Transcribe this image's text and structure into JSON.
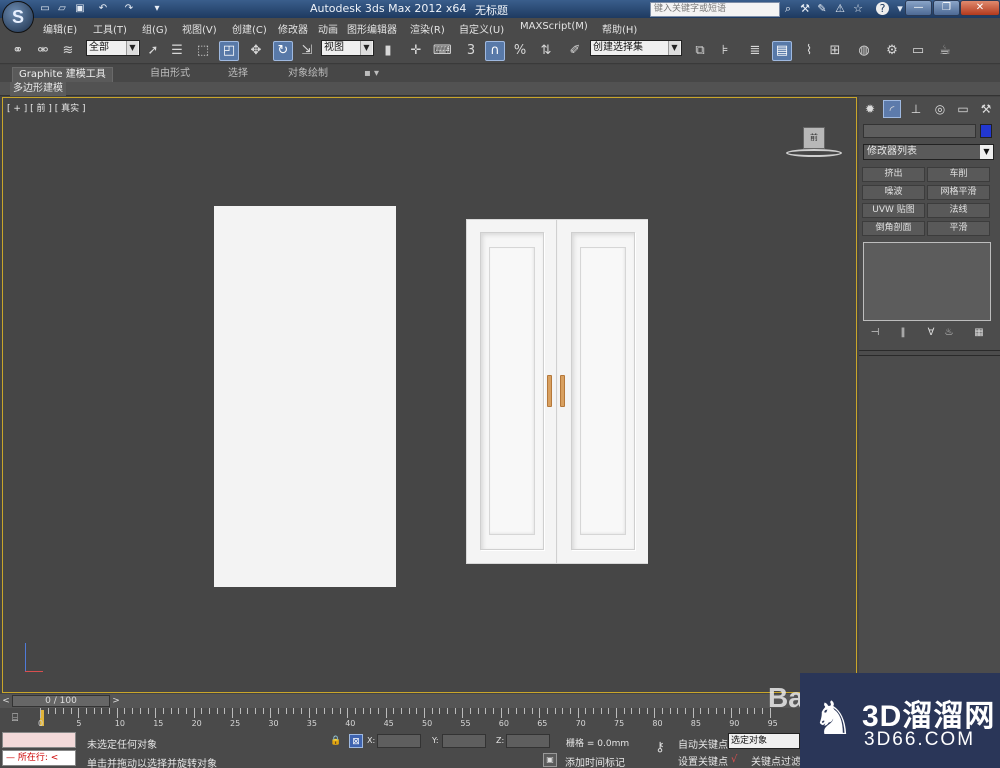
{
  "titlebar": {
    "app_title": "Autodesk 3ds Max  2012 x64",
    "document": "无标题",
    "search_placeholder": "键入关键字或短语",
    "help_symbol": "?"
  },
  "menu": [
    "编辑(E)",
    "工具(T)",
    "组(G)",
    "视图(V)",
    "创建(C)",
    "修改器",
    "动画",
    "图形编辑器",
    "渲染(R)",
    "自定义(U)",
    "MAXScript(M)",
    "帮助(H)"
  ],
  "toolbar": {
    "selection_filter": "全部",
    "ref_coord": "视图",
    "named_selection": "创建选择集",
    "snap_label": "3"
  },
  "ribbon": {
    "tabs": [
      "Graphite 建模工具",
      "自由形式",
      "选择",
      "对象绘制"
    ],
    "panel": "多边形建模"
  },
  "viewport": {
    "label": "[ + ] [ 前 ] [ 真实 ]",
    "viewcube_face": "前"
  },
  "command_panel": {
    "modifier_list": "修改器列表",
    "buttons": [
      "挤出",
      "车削",
      "噪波",
      "网格平滑",
      "UVW 贴图",
      "法线",
      "倒角剖面",
      "平滑"
    ]
  },
  "timeline": {
    "frame": "0 / 100",
    "ticks": [
      "0",
      "5",
      "10",
      "15",
      "20",
      "25",
      "30",
      "35",
      "40",
      "45",
      "50",
      "55",
      "60",
      "65",
      "70",
      "75",
      "80",
      "85",
      "90",
      "95"
    ]
  },
  "status": {
    "script_label": "所在行:",
    "selection": "未选定任何对象",
    "prompt": "单击并拖动以选择并旋转对象",
    "x_label": "X:",
    "y_label": "Y:",
    "z_label": "Z:",
    "grid": "栅格 = 0.0mm",
    "add_time_tag": "添加时间标记",
    "auto_key": "自动关键点",
    "set_key": "设置关键点",
    "selected_object": "选定对象",
    "key_filter": "关键点过滤"
  },
  "watermark": {
    "title": "3D溜溜网",
    "url": "3D66.COM",
    "baidu": "Bai"
  }
}
